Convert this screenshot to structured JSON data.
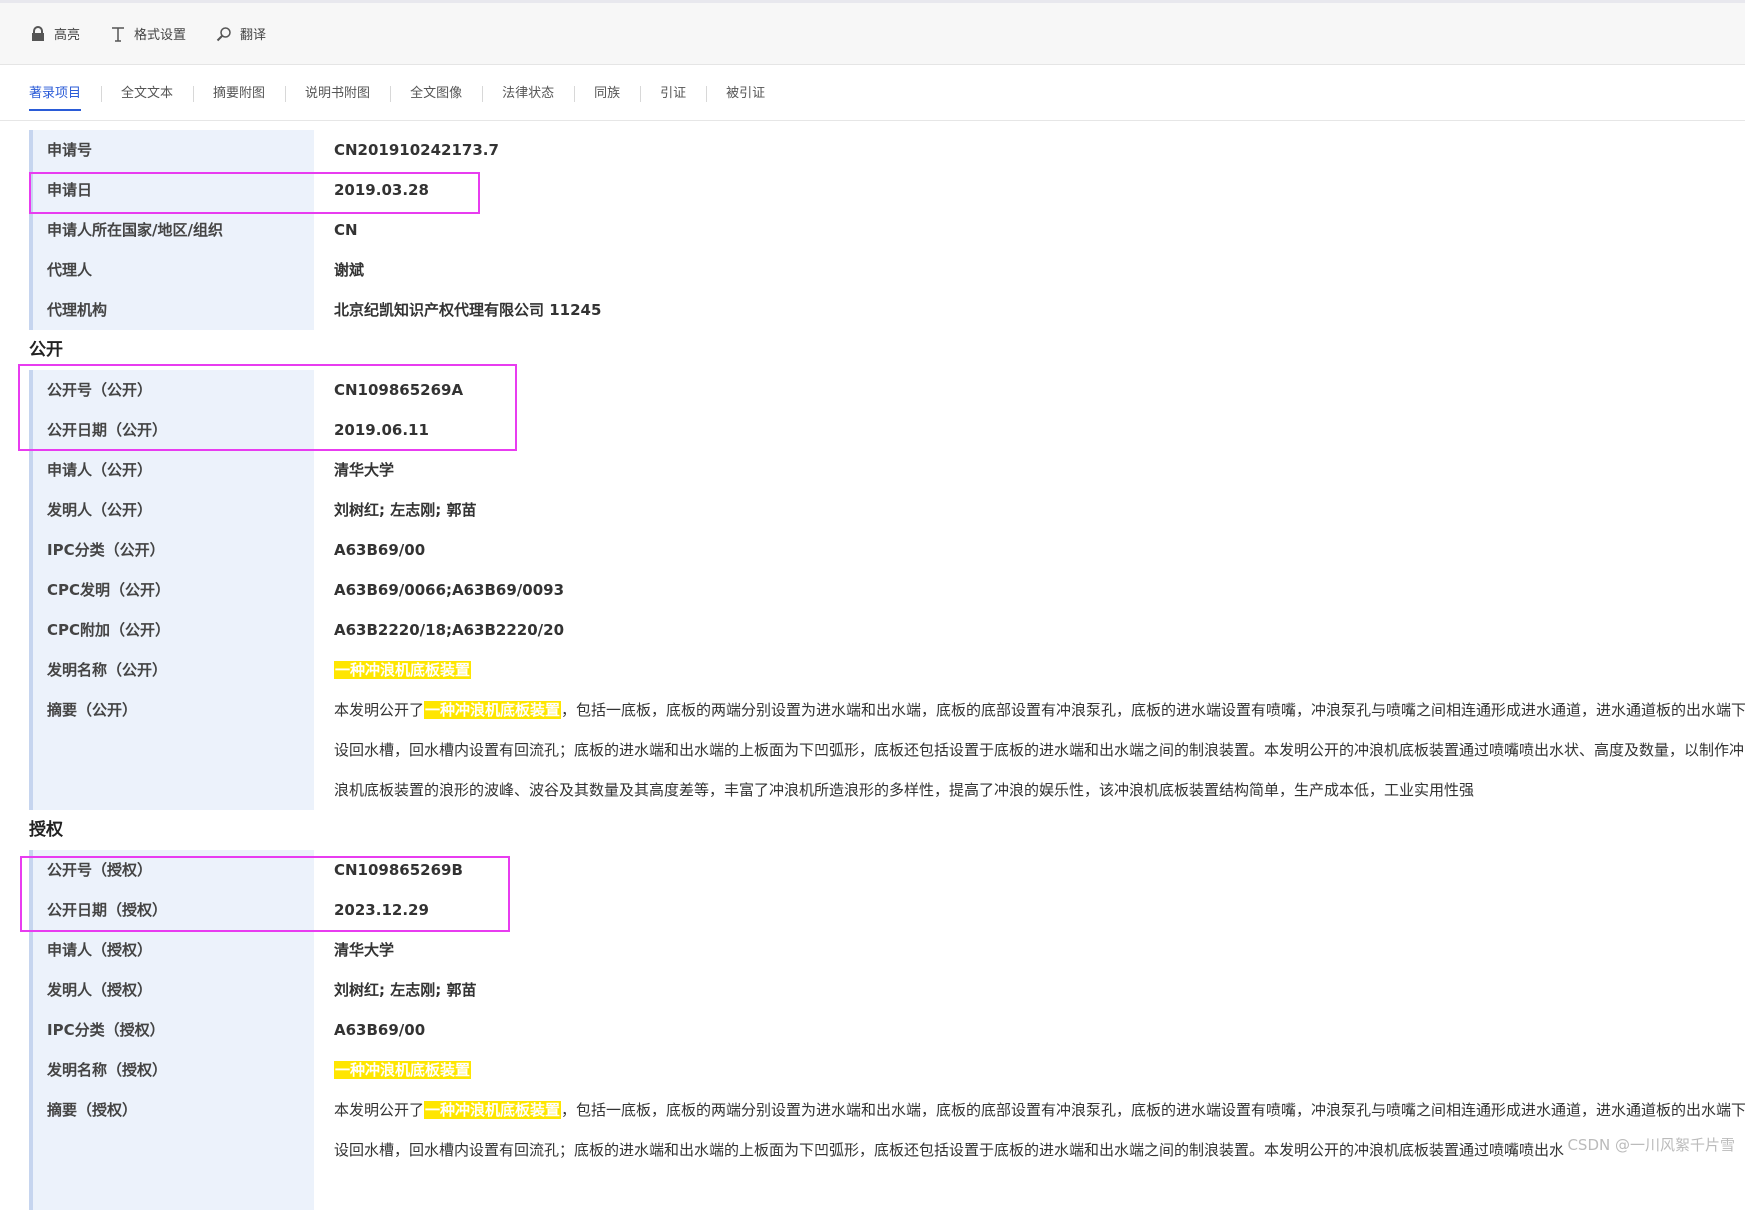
{
  "toolbar": {
    "highlight": "高亮",
    "format": "格式设置",
    "translate": "翻译"
  },
  "tabs": [
    "著录项目",
    "全文文本",
    "摘要附图",
    "说明书附图",
    "全文图像",
    "法律状态",
    "同族",
    "引证",
    "被引证"
  ],
  "application": {
    "app_no_label": "申请号",
    "app_no": "CN201910242173.7",
    "app_date_label": "申请日",
    "app_date": "2019.03.28",
    "country_label": "申请人所在国家/地区/组织",
    "country": "CN",
    "agent_label": "代理人",
    "agent": "谢斌",
    "agency_label": "代理机构",
    "agency": "北京纪凯知识产权代理有限公司 11245"
  },
  "publication": {
    "section": "公开",
    "pub_no_label": "公开号（公开）",
    "pub_no": "CN109865269A",
    "pub_date_label": "公开日期（公开）",
    "pub_date": "2019.06.11",
    "applicant_label": "申请人（公开）",
    "applicant": "清华大学",
    "inventor_label": "发明人（公开）",
    "inventor": "刘树红; 左志刚; 郭苗",
    "ipc_label": "IPC分类（公开）",
    "ipc": "A63B69/00",
    "cpc_inv_label": "CPC发明（公开）",
    "cpc_inv": "A63B69/0066;A63B69/0093",
    "cpc_add_label": "CPC附加（公开）",
    "cpc_add": "A63B2220/18;A63B2220/20",
    "title_label": "发明名称（公开）",
    "title": "一种冲浪机底板装置",
    "abstract_label": "摘要（公开）",
    "abstract_pre": "本发明公开了",
    "abstract_hl": "一种冲浪机底板装置",
    "abstract_rest": "，包括一底板，底板的两端分别设置为进水端和出水端，底板的底部设置有冲浪泵孔，底板的进水端设置有喷嘴，冲浪泵孔与喷嘴之间相连通形成进水通道，进水通道板的出水端下设回水槽，回水槽内设置有回流孔；底板的进水端和出水端的上板面为下凹弧形，底板还包括设置于底板的进水端和出水端之间的制浪装置。本发明公开的冲浪机底板装置通过喷嘴喷出水状、高度及数量，以制作冲浪机底板装置的浪形的波峰、波谷及其数量及其高度差等，丰富了冲浪机所造浪形的多样性，提高了冲浪的娱乐性，该冲浪机底板装置结构简单，生产成本低，工业实用性强"
  },
  "grant": {
    "section": "授权",
    "pub_no_label": "公开号（授权）",
    "pub_no": "CN109865269B",
    "pub_date_label": "公开日期（授权）",
    "pub_date": "2023.12.29",
    "applicant_label": "申请人（授权）",
    "applicant": "清华大学",
    "inventor_label": "发明人（授权）",
    "inventor": "刘树红; 左志刚; 郭苗",
    "ipc_label": "IPC分类（授权）",
    "ipc": "A63B69/00",
    "title_label": "发明名称（授权）",
    "title": "一种冲浪机底板装置",
    "abstract_label": "摘要（授权）",
    "abstract_pre": "本发明公开了",
    "abstract_hl": "一种冲浪机底板装置",
    "abstract_rest": "，包括一底板，底板的两端分别设置为进水端和出水端，底板的底部设置有冲浪泵孔，底板的进水端设置有喷嘴，冲浪泵孔与喷嘴之间相连通形成进水通道，进水通道板的出水端下设回水槽，回水槽内设置有回流孔；底板的进水端和出水端的上板面为下凹弧形，底板还包括设置于底板的进水端和出水端之间的制浪装置。本发明公开的冲浪机底板装置通过喷嘴喷出水"
  },
  "watermark": "CSDN @一川风絮千片雪",
  "colors": {
    "accent": "#2a5bd7",
    "label_bg": "#ecf2fb",
    "highlight": "#ffe600",
    "annotation_box": "#e83cf0"
  }
}
